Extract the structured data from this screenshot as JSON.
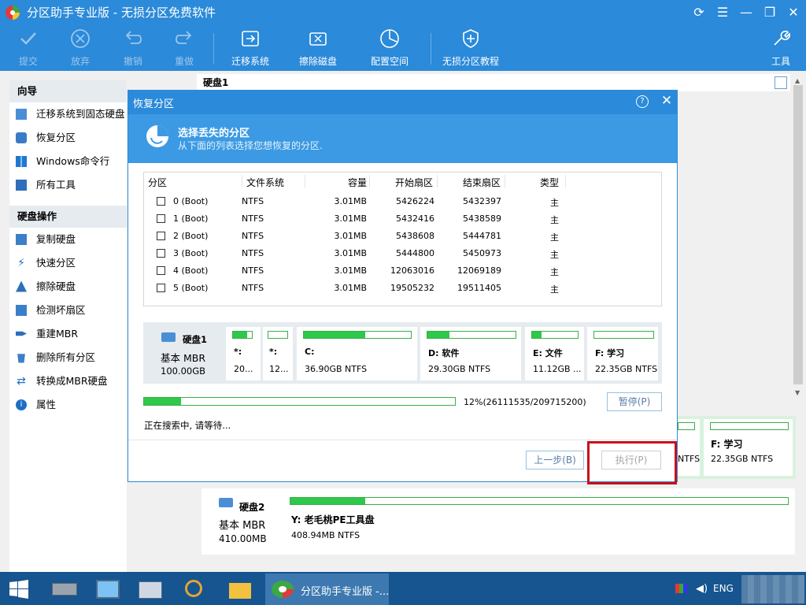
{
  "window": {
    "title": "分区助手专业版 - 无损分区免费软件"
  },
  "toolbar": {
    "commit": "提交",
    "discard": "放弃",
    "undo": "撤销",
    "redo": "重做",
    "migrate": "迁移系统",
    "wipe": "擦除磁盘",
    "allocate": "配置空间",
    "tutorial": "无损分区教程",
    "tools": "工具"
  },
  "sidebar": {
    "wizard_heading": "向导",
    "wizard_items": [
      "迁移系统到固态硬盘",
      "恢复分区",
      "Windows命令行",
      "所有工具"
    ],
    "disk_heading": "硬盘操作",
    "disk_items": [
      "复制硬盘",
      "快速分区",
      "擦除硬盘",
      "检测坏扇区",
      "重建MBR",
      "删除所有分区",
      "转换成MBR硬盘",
      "属性"
    ]
  },
  "main": {
    "disk1_header": "硬盘1",
    "bg_partition_label": "F: 学习",
    "bg_partition_info": "22.35GB NTFS",
    "bg_partial_info": "NTFS"
  },
  "dialog": {
    "title": "恢复分区",
    "banner_title": "选择丢失的分区",
    "banner_subtitle": "从下面的列表选择您想恢复的分区.",
    "columns": [
      "分区",
      "文件系统",
      "容量",
      "开始扇区",
      "结束扇区",
      "类型"
    ],
    "rows": [
      {
        "name": "0 (Boot)",
        "fs": "NTFS",
        "size": "3.01MB",
        "start": "5426224",
        "end": "5432397",
        "type": "主"
      },
      {
        "name": "1 (Boot)",
        "fs": "NTFS",
        "size": "3.01MB",
        "start": "5432416",
        "end": "5438589",
        "type": "主"
      },
      {
        "name": "2 (Boot)",
        "fs": "NTFS",
        "size": "3.01MB",
        "start": "5438608",
        "end": "5444781",
        "type": "主"
      },
      {
        "name": "3 (Boot)",
        "fs": "NTFS",
        "size": "3.01MB",
        "start": "5444800",
        "end": "5450973",
        "type": "主"
      },
      {
        "name": "4 (Boot)",
        "fs": "NTFS",
        "size": "3.01MB",
        "start": "12063016",
        "end": "12069189",
        "type": "主"
      },
      {
        "name": "5 (Boot)",
        "fs": "NTFS",
        "size": "3.01MB",
        "start": "19505232",
        "end": "19511405",
        "type": "主"
      }
    ],
    "disk": {
      "name": "硬盘1",
      "type": "基本 MBR",
      "size": "100.00GB"
    },
    "partitions": [
      {
        "label": "*:",
        "info": "20...",
        "fill": 0.75
      },
      {
        "label": "*:",
        "info": "12...",
        "fill": 0.0
      },
      {
        "label": "C:",
        "info": "36.90GB NTFS",
        "fill": 0.57
      },
      {
        "label": "D: 软件",
        "info": "29.30GB NTFS",
        "fill": 0.25
      },
      {
        "label": "E: 文件",
        "info": "11.12GB ...",
        "fill": 0.2
      },
      {
        "label": "F: 学习",
        "info": "22.35GB NTFS",
        "fill": 0.0
      }
    ],
    "progress_text": "12%(26111535/209715200)",
    "progress_fraction": 0.12,
    "pause_button": "暂停(P)",
    "status": "正在搜索中, 请等待...",
    "back_button": "上一步(B)",
    "execute_button": "执行(P)"
  },
  "disk2": {
    "name": "硬盘2",
    "type": "基本 MBR",
    "size": "410.00MB",
    "partition_label": "Y: 老毛桃PE工具盘",
    "partition_info": "408.94MB NTFS",
    "fill": 0.15
  },
  "taskbar": {
    "active_label": "分区助手专业版 -...",
    "lang": "ENG"
  }
}
